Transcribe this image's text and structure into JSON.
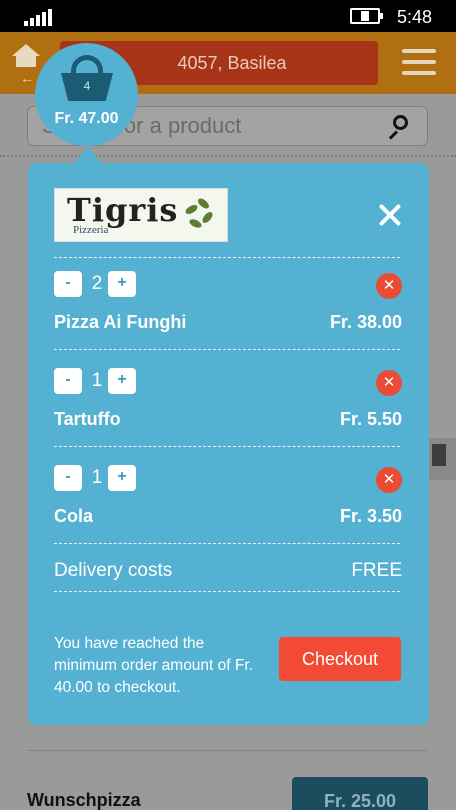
{
  "status_bar": {
    "time": "5:48"
  },
  "header": {
    "location": "4057, Basilea"
  },
  "search": {
    "placeholder": "Search for a product"
  },
  "cart": {
    "count": "4",
    "total": "Fr. 47.00",
    "restaurant": {
      "name": "Tigris",
      "subtitle": "Pizzeria"
    },
    "items": [
      {
        "qty": "2",
        "name": "Pizza Ai Funghi",
        "price": "Fr. 38.00"
      },
      {
        "qty": "1",
        "name": "Tartuffo",
        "price": "Fr. 5.50"
      },
      {
        "qty": "1",
        "name": "Cola",
        "price": "Fr. 3.50"
      }
    ],
    "stepper": {
      "minus": "-",
      "plus": "+"
    },
    "remove_glyph": "✕",
    "delivery_label": "Delivery costs",
    "delivery_value": "FREE",
    "min_message": "You have reached the minimum order amount of Fr. 40.00 to checkout.",
    "checkout_label": "Checkout"
  },
  "background_menu": {
    "item_name": "Wunschpizza",
    "item_price": "Fr. 25.00"
  },
  "colors": {
    "cart_bg": "#54b1d2",
    "checkout": "#f24a35",
    "header_bg": "#b06f10"
  },
  "icons": [
    "signal-icon",
    "battery-charging-icon",
    "home-icon",
    "back-arrow-icon",
    "hamburger-menu-icon",
    "search-icon",
    "basket-icon",
    "close-icon",
    "remove-icon"
  ]
}
